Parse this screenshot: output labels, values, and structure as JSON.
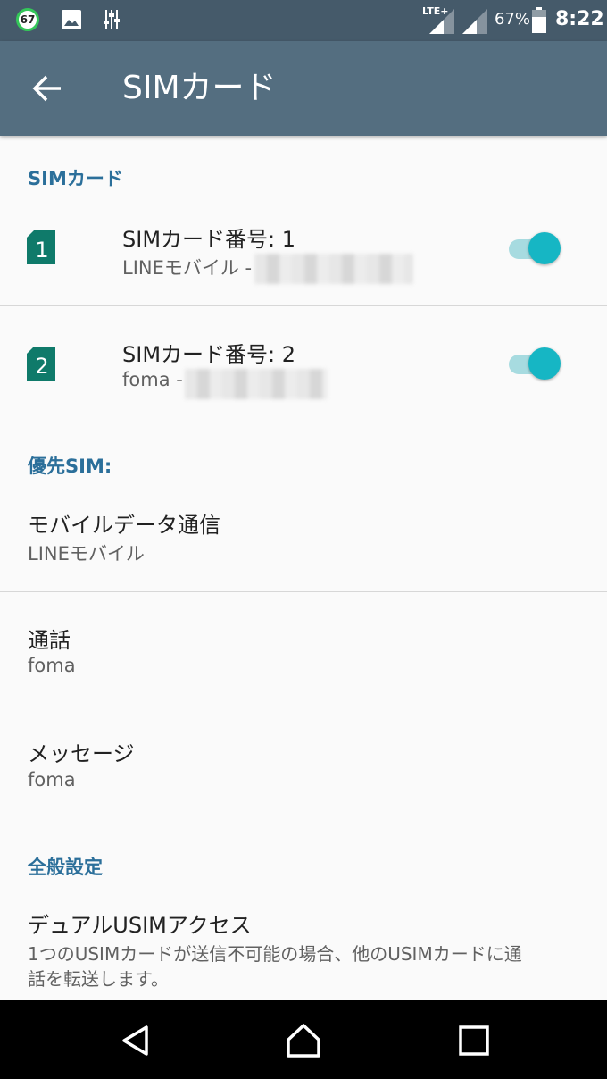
{
  "status_bar": {
    "notification_count": "67",
    "network_type": "LTE+",
    "battery_percent": "67%",
    "time": "8:22"
  },
  "app_bar": {
    "title": "SIMカード"
  },
  "sim_section": {
    "header": "SIMカード",
    "cards": [
      {
        "slot": "1",
        "title": "SIMカード番号: 1",
        "subtitle": "LINEモバイル -",
        "enabled": true
      },
      {
        "slot": "2",
        "title": "SIMカード番号: 2",
        "subtitle": "foma -",
        "enabled": true
      }
    ]
  },
  "preferred_section": {
    "header": "優先SIM:",
    "items": [
      {
        "title": "モバイルデータ通信",
        "value": "LINEモバイル"
      },
      {
        "title": "通話",
        "value": "foma"
      },
      {
        "title": "メッセージ",
        "value": "foma"
      }
    ]
  },
  "general_section": {
    "header": "全般設定",
    "items": [
      {
        "title": "デュアルUSIMアクセス",
        "description_line1": "1つのUSIMカードが送信不可能の場合、他のUSIMカードに通",
        "description_line2": "話を転送します。"
      }
    ]
  },
  "colors": {
    "status_bar": "#455a6a",
    "app_bar": "#546e80",
    "accent": "#16b6c4",
    "section_header": "#2b6f9a",
    "sim_icon": "#0f7a6a"
  }
}
